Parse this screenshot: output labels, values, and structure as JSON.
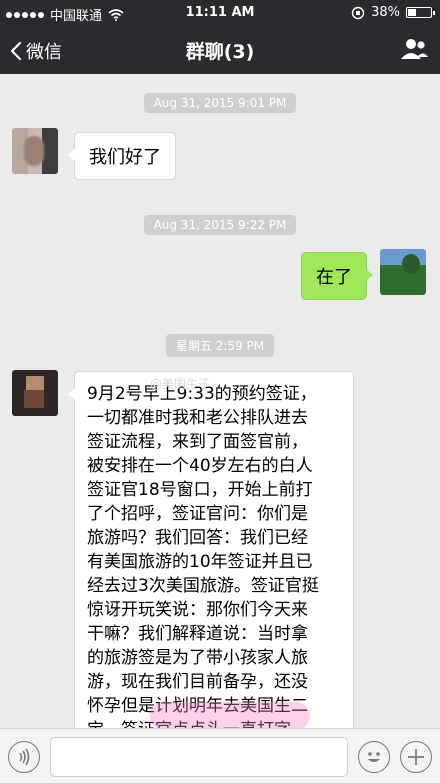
{
  "status_bar": {
    "carrier": "中国联通",
    "time": "11:11 AM",
    "battery_text": "38%",
    "battery_level": 0.38
  },
  "nav": {
    "back_label": "微信",
    "title": "群聊(3)"
  },
  "chat": {
    "messages": [
      {
        "type": "timestamp",
        "text": "Aug 31, 2015 9:01 PM"
      },
      {
        "type": "incoming",
        "text": "我们好了"
      },
      {
        "type": "timestamp",
        "text": "Aug 31, 2015 9:22 PM"
      },
      {
        "type": "outgoing",
        "text": "在了"
      },
      {
        "type": "timestamp",
        "text": "星期五 2:59 PM"
      },
      {
        "type": "incoming",
        "lines": [
          "9月2号早上9:33的预约签证，",
          "一切都准时我和老公排队进去",
          "签证流程，来到了面签官前，",
          "被安排在一个40岁左右的白人",
          "签证官18号窗口，开始上前打",
          "了个招呼，签证官问：你们是",
          "旅游吗？我们回答：我们已经",
          "有美国旅游的10年签证并且已",
          "经去过3次美国旅游。签证官挺",
          "惊讶开玩笑说：那你们今天来",
          "干嘛？我们解释道说：当时拿",
          "的旅游签是为了带小孩家人旅",
          "游，现在我们目前备孕，还没",
          "怀孕但是计划明年去美国生二",
          "宝，签证官点点头一直打字"
        ]
      }
    ],
    "watermark": "@美国生子"
  },
  "input_bar": {
    "text_value": ""
  },
  "colors": {
    "bar_bg": "#2b2b2f",
    "chat_bg": "#ebebeb",
    "outgoing_bubble": "#a0e75a"
  }
}
